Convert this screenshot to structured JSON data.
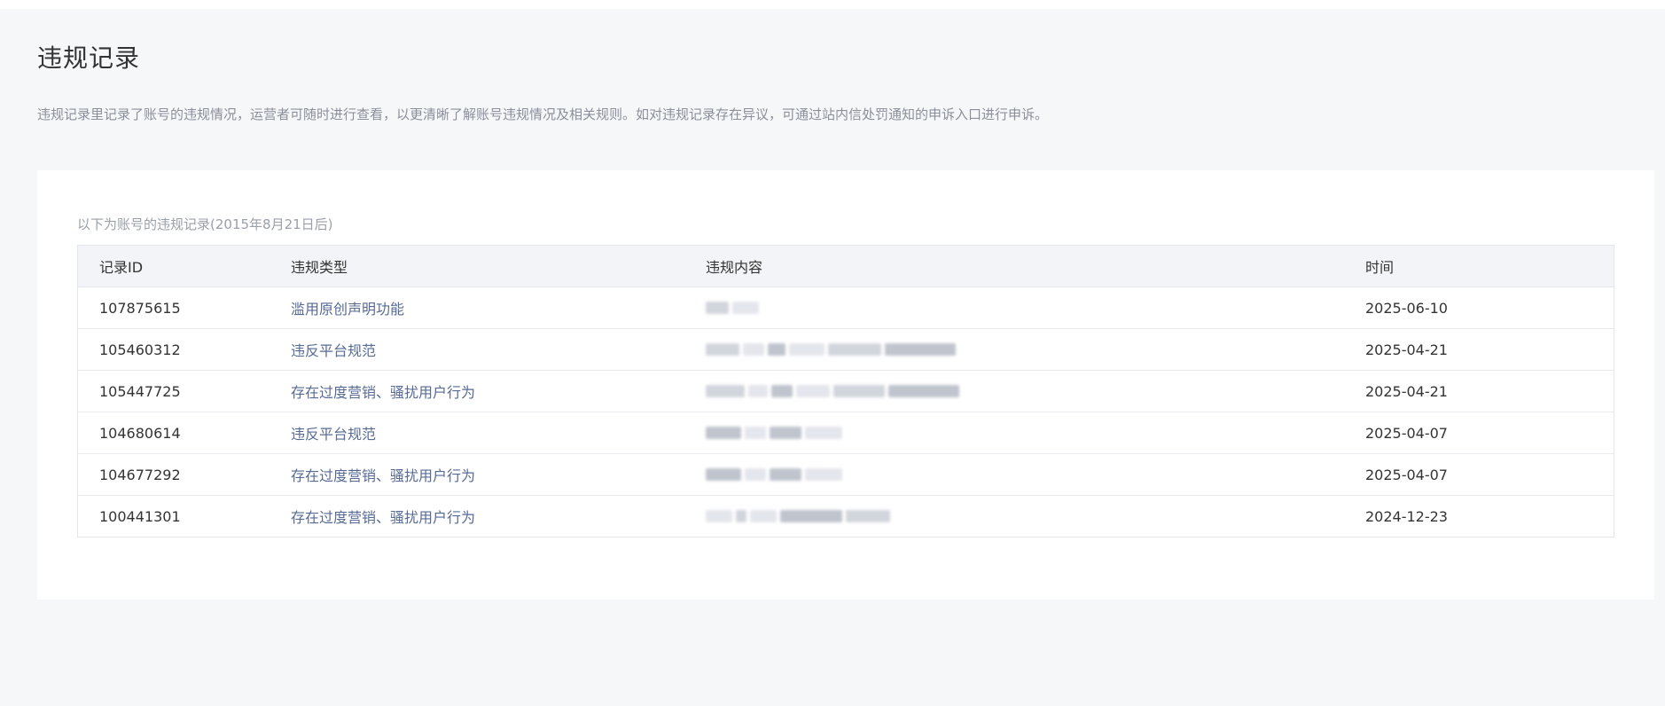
{
  "page": {
    "title": "违规记录",
    "description": "违规记录里记录了账号的违规情况，运营者可随时进行查看，以更清晰了解账号违规情况及相关规则。如对违规记录存在异议，可通过站内信处罚通知的申诉入口进行申诉。"
  },
  "card": {
    "caption": "以下为账号的违规记录(2015年8月21日后)"
  },
  "table": {
    "columns": [
      "记录ID",
      "违规类型",
      "违规内容",
      "时间"
    ],
    "rows": [
      {
        "id": "107875615",
        "type": "滥用原创声明功能",
        "content_icon": "blurred-content",
        "time": "2025-06-10"
      },
      {
        "id": "105460312",
        "type": "违反平台规范",
        "content_icon": "blurred-content",
        "time": "2025-04-21"
      },
      {
        "id": "105447725",
        "type": "存在过度营销、骚扰用户行为",
        "content_icon": "blurred-content",
        "time": "2025-04-21"
      },
      {
        "id": "104680614",
        "type": "违反平台规范",
        "content_icon": "blurred-content",
        "time": "2025-04-07"
      },
      {
        "id": "104677292",
        "type": "存在过度营销、骚扰用户行为",
        "content_icon": "blurred-content",
        "time": "2025-04-07"
      },
      {
        "id": "100441301",
        "type": "存在过度营销、骚扰用户行为",
        "content_icon": "blurred-content",
        "time": "2024-12-23"
      }
    ]
  },
  "colors": {
    "page_bg": "#f6f7f9",
    "card_bg": "#ffffff",
    "link": "#576b95",
    "header_bg": "#f2f4f7",
    "border": "#e3e6eb"
  }
}
